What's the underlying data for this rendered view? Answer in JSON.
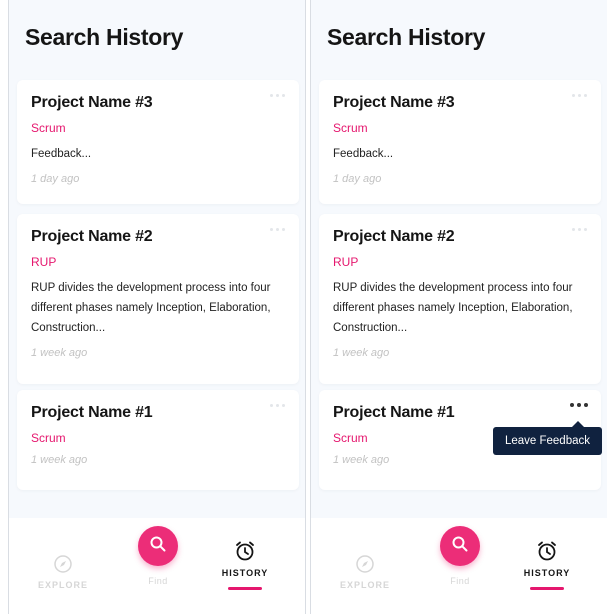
{
  "screens": [
    {
      "title": "Search History",
      "cards": [
        {
          "title": "Project Name #3",
          "method": "Scrum",
          "desc": "Feedback...",
          "time": "1 day ago"
        },
        {
          "title": "Project Name #2",
          "method": "RUP",
          "desc": "RUP divides the development process into four different phases namely Inception, Elaboration, Construction...",
          "time": "1 week ago"
        },
        {
          "title": "Project Name #1",
          "method": "Scrum",
          "desc": "",
          "time": "1 week ago"
        }
      ],
      "tabs": {
        "explore": "EXPLORE",
        "find": "Find",
        "history": "HISTORY"
      }
    },
    {
      "title": "Search History",
      "cards": [
        {
          "title": "Project Name #3",
          "method": "Scrum",
          "desc": "Feedback...",
          "time": "1 day ago"
        },
        {
          "title": "Project Name #2",
          "method": "RUP",
          "desc": "RUP divides the development process into four different phases namely Inception, Elaboration, Construction...",
          "time": "1 week ago"
        },
        {
          "title": "Project Name #1",
          "method": "Scrum",
          "desc": "",
          "time": "1 week ago"
        }
      ],
      "tabs": {
        "explore": "EXPLORE",
        "find": "Find",
        "history": "HISTORY"
      },
      "tooltip": "Leave Feedback"
    }
  ],
  "colors": {
    "accent": "#e5176e",
    "tooltip_bg": "#10223f",
    "muted": "#c2c2c2"
  },
  "icons": [
    "more-icon",
    "compass-icon",
    "search-icon",
    "alarm-clock-icon"
  ]
}
